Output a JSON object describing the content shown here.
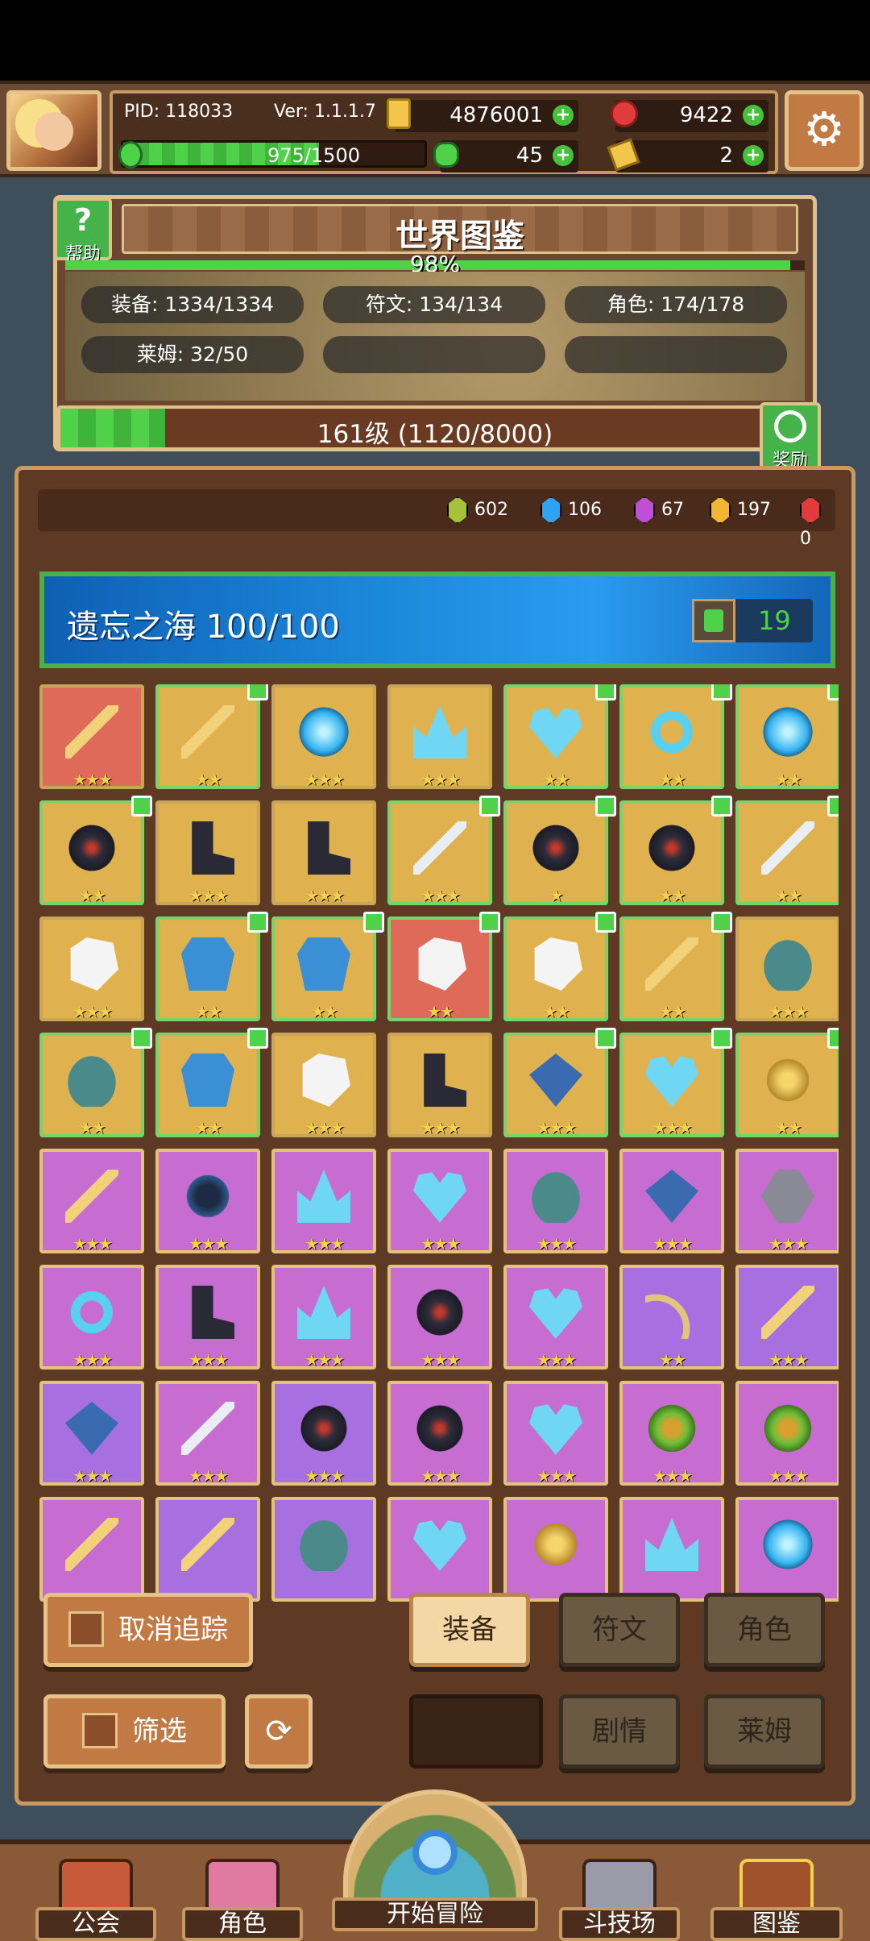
{
  "header": {
    "pid": "PID: 118033",
    "version": "Ver: 1.1.1.7",
    "gold": "4876001",
    "red_gem": "9422",
    "exp_text": "975/1500",
    "exp_fraction": 0.65,
    "clover": "45",
    "ticket": "2"
  },
  "codex": {
    "title": "世界图鉴",
    "help_label": "帮助",
    "percent": "98%",
    "percent_value": 0.98,
    "stats": {
      "equipment": "装备: 1334/1334",
      "runes": "符文: 134/134",
      "characters": "角色: 174/178",
      "slime": "莱姆: 32/50"
    },
    "level_text": "161级 (1120/8000)",
    "level_fraction": 0.14,
    "reward_label": "奖励"
  },
  "gems": [
    {
      "color": "#a6c23a",
      "count": "602"
    },
    {
      "color": "#2ea4f0",
      "count": "106"
    },
    {
      "color": "#c04fd8",
      "count": "67"
    },
    {
      "color": "#f2b632",
      "count": "197"
    },
    {
      "color": "#e23b3b",
      "count": "0"
    }
  ],
  "region": {
    "title": "遗忘之海  100/100",
    "likes": "19"
  },
  "items": [
    {
      "bg": "red",
      "shape": "wand",
      "stars": "★★★",
      "tracked": false
    },
    {
      "bg": "gold",
      "shape": "wand",
      "stars": "★★",
      "tracked": true
    },
    {
      "bg": "gold",
      "shape": "orb",
      "stars": "★★★",
      "tracked": false
    },
    {
      "bg": "gold",
      "shape": "crown",
      "stars": "★★★",
      "tracked": false
    },
    {
      "bg": "gold",
      "shape": "heart",
      "stars": "★★",
      "tracked": true
    },
    {
      "bg": "gold",
      "shape": "ring",
      "stars": "★★",
      "tracked": true
    },
    {
      "bg": "gold",
      "shape": "orb",
      "stars": "★★",
      "tracked": true
    },
    {
      "bg": "gold",
      "shape": "dark",
      "stars": "★★",
      "tracked": true
    },
    {
      "bg": "gold",
      "shape": "boot",
      "stars": "★★★",
      "tracked": false
    },
    {
      "bg": "gold",
      "shape": "boot",
      "stars": "★★★",
      "tracked": false
    },
    {
      "bg": "gold",
      "shape": "sword",
      "stars": "★★★",
      "tracked": true
    },
    {
      "bg": "gold",
      "shape": "dark",
      "stars": "★",
      "tracked": true
    },
    {
      "bg": "gold",
      "shape": "dark",
      "stars": "★★",
      "tracked": true
    },
    {
      "bg": "gold",
      "shape": "sword",
      "stars": "★★",
      "tracked": true
    },
    {
      "bg": "gold",
      "shape": "glove",
      "stars": "★★★",
      "tracked": false
    },
    {
      "bg": "gold",
      "shape": "armor",
      "stars": "★★",
      "tracked": true
    },
    {
      "bg": "gold",
      "shape": "armor",
      "stars": "★★",
      "tracked": true
    },
    {
      "bg": "red",
      "shape": "glove",
      "stars": "★★",
      "tracked": true
    },
    {
      "bg": "gold",
      "shape": "glove",
      "stars": "★★",
      "tracked": true
    },
    {
      "bg": "gold",
      "shape": "wand",
      "stars": "★★",
      "tracked": true
    },
    {
      "bg": "gold",
      "shape": "helm",
      "stars": "★★★",
      "tracked": false
    },
    {
      "bg": "gold",
      "shape": "helm",
      "stars": "★★",
      "tracked": true
    },
    {
      "bg": "gold",
      "shape": "armor",
      "stars": "★★",
      "tracked": true
    },
    {
      "bg": "gold",
      "shape": "glove",
      "stars": "★★★",
      "tracked": false
    },
    {
      "bg": "gold",
      "shape": "boot",
      "stars": "★★★",
      "tracked": false
    },
    {
      "bg": "gold",
      "shape": "amulet",
      "stars": "★★★",
      "tracked": true
    },
    {
      "bg": "gold",
      "shape": "heart",
      "stars": "★★★",
      "tracked": true
    },
    {
      "bg": "gold",
      "shape": "gold",
      "stars": "★★",
      "tracked": true
    },
    {
      "bg": "purple",
      "shape": "wand",
      "stars": "★★★",
      "tracked": false
    },
    {
      "bg": "purple",
      "shape": "mono",
      "stars": "★★★",
      "tracked": false
    },
    {
      "bg": "purple",
      "shape": "crown",
      "stars": "★★★",
      "tracked": false
    },
    {
      "bg": "purple",
      "shape": "heart",
      "stars": "★★★",
      "tracked": false
    },
    {
      "bg": "purple",
      "shape": "helm",
      "stars": "★★★",
      "tracked": false
    },
    {
      "bg": "purple",
      "shape": "amulet",
      "stars": "★★★",
      "tracked": false
    },
    {
      "bg": "purple",
      "shape": "purple-item",
      "stars": "★★★",
      "tracked": false
    },
    {
      "bg": "purple",
      "shape": "ring",
      "stars": "★★★",
      "tracked": false
    },
    {
      "bg": "purple",
      "shape": "boot",
      "stars": "★★★",
      "tracked": false
    },
    {
      "bg": "purple",
      "shape": "crown",
      "stars": "★★★",
      "tracked": false
    },
    {
      "bg": "purple",
      "shape": "dark",
      "stars": "★★★",
      "tracked": false
    },
    {
      "bg": "purple",
      "shape": "heart",
      "stars": "★★★",
      "tracked": false
    },
    {
      "bg": "violet",
      "shape": "bow",
      "stars": "★★",
      "tracked": false
    },
    {
      "bg": "violet",
      "shape": "wand",
      "stars": "★★★",
      "tracked": false
    },
    {
      "bg": "violet",
      "shape": "amulet",
      "stars": "★★★",
      "tracked": false
    },
    {
      "bg": "purple",
      "shape": "sword",
      "stars": "★★★",
      "tracked": false
    },
    {
      "bg": "violet",
      "shape": "dark",
      "stars": "★★★",
      "tracked": false
    },
    {
      "bg": "purple",
      "shape": "dark",
      "stars": "★★★",
      "tracked": false
    },
    {
      "bg": "purple",
      "shape": "heart",
      "stars": "★★★",
      "tracked": false
    },
    {
      "bg": "purple",
      "shape": "frog",
      "stars": "★★★",
      "tracked": false
    },
    {
      "bg": "purple",
      "shape": "frog",
      "stars": "★★★",
      "tracked": false
    },
    {
      "bg": "purple",
      "shape": "wand",
      "stars": "",
      "tracked": false
    },
    {
      "bg": "violet",
      "shape": "wand",
      "stars": "",
      "tracked": false
    },
    {
      "bg": "violet",
      "shape": "helm",
      "stars": "",
      "tracked": false
    },
    {
      "bg": "purple",
      "shape": "heart",
      "stars": "",
      "tracked": false
    },
    {
      "bg": "purple",
      "shape": "gold",
      "stars": "",
      "tracked": false
    },
    {
      "bg": "purple",
      "shape": "crown",
      "stars": "",
      "tracked": false
    },
    {
      "bg": "purple",
      "shape": "orb",
      "stars": "",
      "tracked": false
    }
  ],
  "controls": {
    "untrack": "取消追踪",
    "filter": "筛选",
    "tab_equipment": "装备",
    "tab_runes": "符文",
    "tab_characters": "角色",
    "tab_story": "剧情",
    "tab_slime": "莱姆"
  },
  "nav": {
    "guild": "公会",
    "character": "角色",
    "adventure": "开始冒险",
    "arena": "斗技场",
    "codex": "图鉴"
  }
}
